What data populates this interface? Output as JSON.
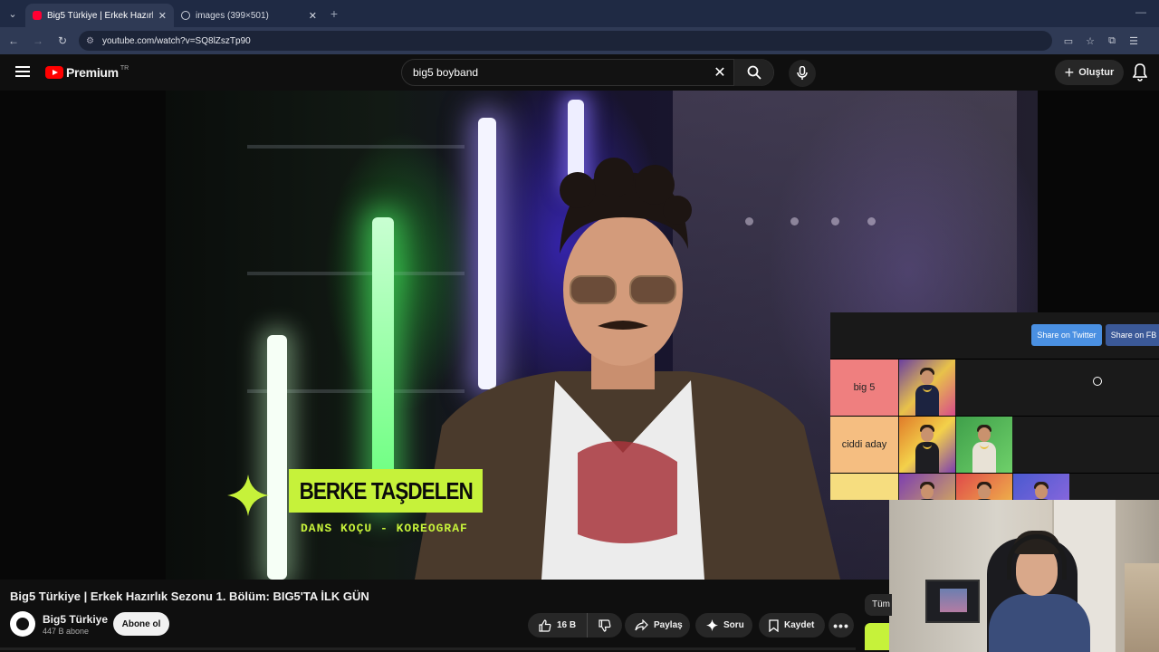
{
  "browser": {
    "tabs": [
      {
        "title": "Big5 Türkiye | Erkek Hazırlık Sezonu",
        "active": true,
        "favicon": "youtube-icon"
      },
      {
        "title": "images (399×501)",
        "active": false,
        "favicon": "globe-icon"
      }
    ],
    "url": "youtube.com/watch?v=SQ8lZszTp90"
  },
  "youtube": {
    "brand": "Premium",
    "region": "TR",
    "search": {
      "value": "big5 boyband"
    },
    "create_label": "Oluştur"
  },
  "video": {
    "lower_third": {
      "name": "BERKE TAŞDELEN",
      "role": "DANS KOÇU - KOREOGRAF"
    }
  },
  "tier_list": {
    "share_twitter": "Share on Twitter",
    "share_fb": "Share on FB",
    "rows": [
      {
        "label": "big 5",
        "color": "#ef7f7f",
        "count": 1
      },
      {
        "label": "ciddi aday",
        "color": "#f5be81",
        "count": 2
      },
      {
        "label": "",
        "color": "#f6dd7f",
        "count": 3
      }
    ]
  },
  "below": {
    "title": "Big5 Türkiye | Erkek Hazırlık Sezonu 1. Bölüm: BIG5'TA İLK GÜN",
    "channel": "Big5 Türkiye",
    "subscribers": "447 B abone",
    "subscribe_label": "Abone ol",
    "likes": "16 B",
    "share_label": "Paylaş",
    "ask_label": "Soru",
    "save_label": "Kaydet",
    "chip_label": "Tüm"
  },
  "colors": {
    "accent": "#ff0000",
    "lower_third": "#c6f23a",
    "twitter": "#4a90e2",
    "facebook": "#3b5998"
  }
}
